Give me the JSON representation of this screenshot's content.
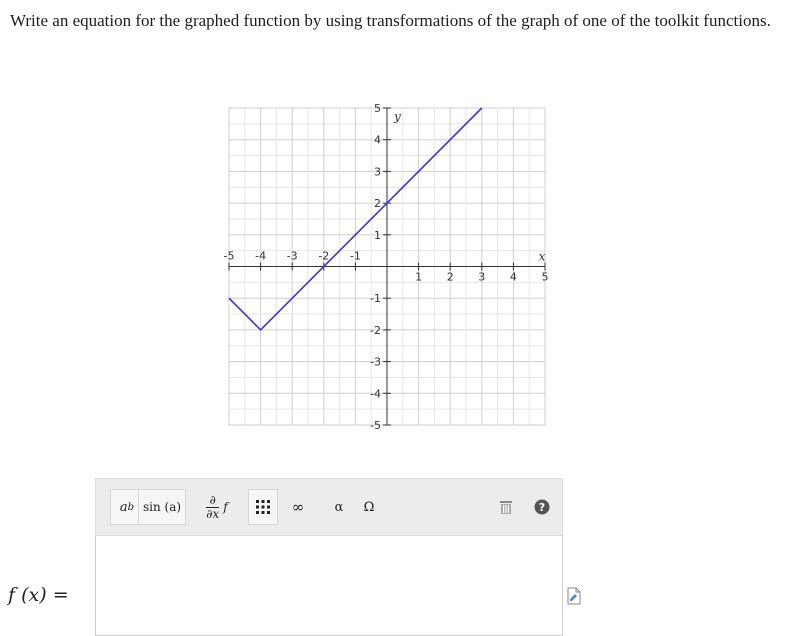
{
  "question": {
    "text": "Write an equation for the graphed function by using transformations of the graph of one of the toolkit functions."
  },
  "graph": {
    "x_axis_label": "x",
    "y_axis_label": "y",
    "x_ticks": [
      "-5",
      "-4",
      "-3",
      "-2",
      "-1",
      "1",
      "2",
      "3",
      "4",
      "5"
    ],
    "y_ticks_pos": [
      "5",
      "4",
      "3",
      "2",
      "1"
    ],
    "y_ticks_neg": [
      "-1",
      "-2",
      "-3",
      "-4",
      "-5"
    ],
    "function_points": [
      [
        -5,
        -1
      ],
      [
        -4,
        -2
      ],
      [
        3,
        5
      ]
    ],
    "line_color": "#3333ee"
  },
  "chart_data": {
    "type": "line",
    "series": [
      {
        "values": [
          [
            -5,
            -1
          ],
          [
            -4,
            -2
          ],
          [
            3,
            5
          ]
        ]
      }
    ],
    "xlim": [
      -5,
      5
    ],
    "ylim": [
      -5,
      5
    ],
    "grid": true,
    "xlabel": "x",
    "ylabel": "y"
  },
  "toolbar": {
    "power_base": "a",
    "power_exp": "b",
    "sin_label": "sin (a)",
    "partial_top": "∂",
    "partial_bottom": "∂x",
    "partial_f": "f",
    "matrix_icon": "matrix-icon",
    "infinity": "∞",
    "alpha": "α",
    "omega": "Ω",
    "trash_icon": "trash-icon",
    "help_icon": "help-icon"
  },
  "answer": {
    "label_f": "f",
    "label_arg": "(x)",
    "label_eq": "=",
    "value": ""
  }
}
